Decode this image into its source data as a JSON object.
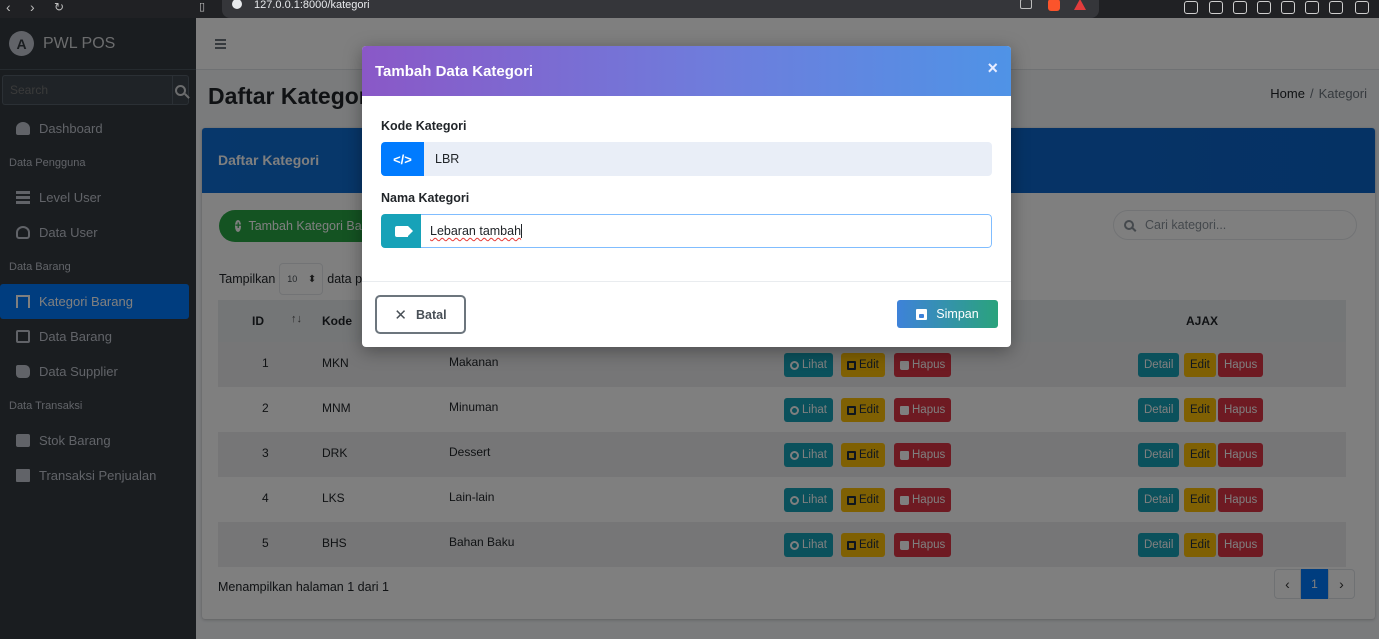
{
  "browser": {
    "url": "127.0.0.1:8000/kategori"
  },
  "sidebar": {
    "brand": "PWL POS",
    "search_placeholder": "Search",
    "items": [
      {
        "type": "item",
        "label": "Dashboard",
        "icon": "dashboard-icon"
      },
      {
        "type": "header",
        "label": "Data Pengguna"
      },
      {
        "type": "item",
        "label": "Level User",
        "icon": "layers-icon"
      },
      {
        "type": "item",
        "label": "Data User",
        "icon": "user-icon"
      },
      {
        "type": "header",
        "label": "Data Barang"
      },
      {
        "type": "item",
        "label": "Kategori Barang",
        "icon": "bookmark-icon",
        "active": true
      },
      {
        "type": "item",
        "label": "Data Barang",
        "icon": "list-icon"
      },
      {
        "type": "item",
        "label": "Data Supplier",
        "icon": "truck-icon"
      },
      {
        "type": "header",
        "label": "Data Transaksi"
      },
      {
        "type": "item",
        "label": "Stok Barang",
        "icon": "cubes-icon"
      },
      {
        "type": "item",
        "label": "Transaksi Penjualan",
        "icon": "cash-register-icon"
      }
    ]
  },
  "page": {
    "title": "Daftar Kategori",
    "breadcrumb": {
      "home": "Home",
      "separator": "/",
      "current": "Kategori"
    },
    "card_title": "Daftar Kategori",
    "add_button": "Tambah Kategori Barang",
    "search_placeholder": "Cari kategori...",
    "length_label": "Tampilkan",
    "length_value": "10",
    "length_suffix": "data per halaman",
    "table": {
      "columns": {
        "id": "ID",
        "kode": "Kode",
        "ajax": "AJAX"
      },
      "rows": [
        {
          "id": "1",
          "kode": "MKN",
          "nama": "Makanan"
        },
        {
          "id": "2",
          "kode": "MNM",
          "nama": "Minuman"
        },
        {
          "id": "3",
          "kode": "DRK",
          "nama": "Dessert"
        },
        {
          "id": "4",
          "kode": "LKS",
          "nama": "Lain-lain"
        },
        {
          "id": "5",
          "kode": "BHS",
          "nama": "Bahan Baku"
        }
      ],
      "actions": {
        "lihat": "Lihat",
        "edit": "Edit",
        "hapus": "Hapus",
        "detail": "Detail"
      }
    },
    "footer_info": "Menampilkan halaman 1 dari 1",
    "pager": {
      "prev": "‹",
      "current": "1",
      "next": "›"
    }
  },
  "modal": {
    "title": "Tambah Data Kategori",
    "close": "×",
    "kode_label": "Kode Kategori",
    "kode_value": "LBR",
    "nama_label": "Nama Kategori",
    "nama_value": "Lebaran tambah",
    "cancel_label": "Batal",
    "save_label": "Simpan"
  },
  "colors": {
    "sidebar_bg": "#343a40",
    "primary": "#007bff",
    "success": "#28a745",
    "info": "#17a2b8",
    "warning": "#ffc107",
    "danger": "#dc3545"
  }
}
